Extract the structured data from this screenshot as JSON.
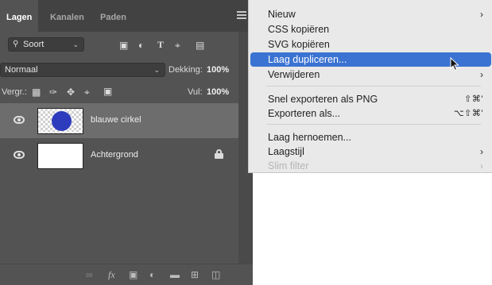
{
  "layers_panel": {
    "tabs": [
      "Lagen",
      "Kanalen",
      "Paden"
    ],
    "filter": {
      "label": "Soort",
      "icons": [
        "image-filter-icon",
        "adjustment-filter-icon",
        "type-filter-icon",
        "shape-filter-icon",
        "smart-object-filter-icon"
      ],
      "type_glyph": "T"
    },
    "blend_mode": "Normaal",
    "opacity": {
      "label": "Dekking:",
      "value": "100%"
    },
    "lock": {
      "label": "Vergr.:"
    },
    "fill": {
      "label": "Vul:",
      "value": "100%"
    },
    "layers": [
      {
        "name": "blauwe cirkel",
        "selected": true,
        "thumb_color": "#2d3bbd"
      },
      {
        "name": "Achtergrond",
        "selected": false,
        "locked": true
      }
    ],
    "bottom_fx": "fx"
  },
  "context_menu": {
    "items": [
      {
        "label": "Nieuw",
        "submenu": true
      },
      {
        "label": "CSS kopiëren"
      },
      {
        "label": "SVG kopiëren"
      },
      {
        "label": "Laag dupliceren...",
        "highlighted": true
      },
      {
        "label": "Verwijderen",
        "submenu": true
      },
      {
        "label": "Snel exporteren als PNG",
        "shortcut": "⇧⌘'"
      },
      {
        "label": "Exporteren als...",
        "shortcut": "⌥⇧⌘'"
      },
      {
        "label": "Laag hernoemen..."
      },
      {
        "label": "Laagstijl",
        "submenu": true
      },
      {
        "label": "Slim filter",
        "submenu": true,
        "disabled": true
      }
    ],
    "arrow_glyph": "›"
  },
  "colors": {
    "highlight": "#3b73d2",
    "panel_bg": "#535353",
    "menu_bg": "#e9e9e9"
  }
}
